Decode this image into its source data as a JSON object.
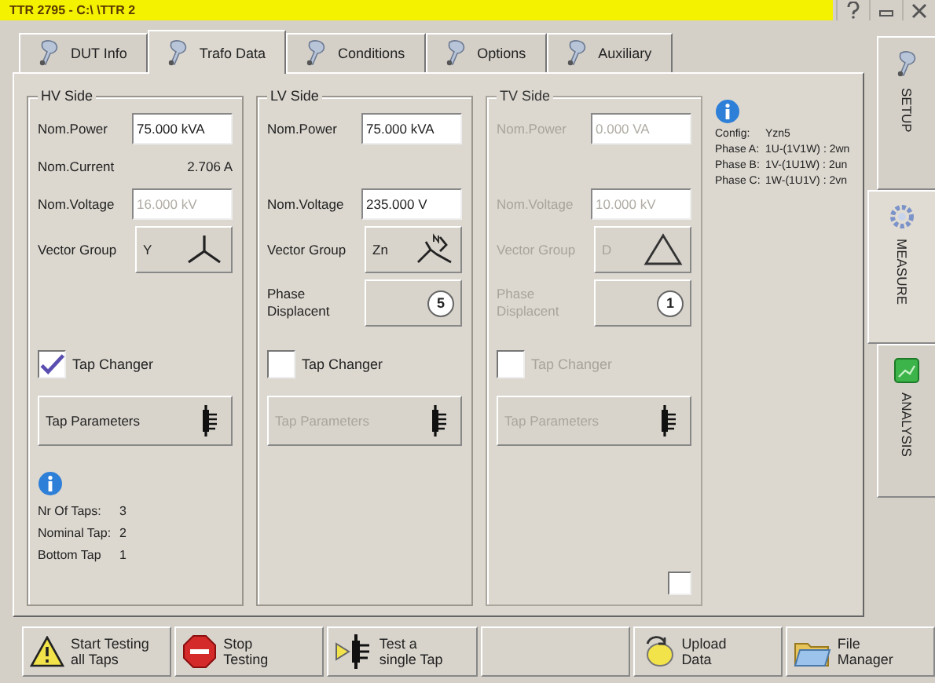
{
  "window": {
    "title": "TTR 2795 - C:\\ \\TTR 2"
  },
  "tabs": [
    {
      "label": "DUT Info",
      "selected": false
    },
    {
      "label": "Trafo Data",
      "selected": true
    },
    {
      "label": "Conditions",
      "selected": false
    },
    {
      "label": "Options",
      "selected": false
    },
    {
      "label": "Auxiliary",
      "selected": false
    }
  ],
  "side_tabs": [
    {
      "label": "SETUP",
      "kind": "wrench",
      "selected": false
    },
    {
      "label": "MEASURE",
      "kind": "gear",
      "selected": true
    },
    {
      "label": "ANALYSIS",
      "kind": "chart",
      "selected": false
    }
  ],
  "sides": [
    {
      "title": "HV Side",
      "disabled": false,
      "fields": [
        {
          "kind": "input",
          "label": "Nom.Power",
          "value": "75.000 kVA",
          "disabled": false
        },
        {
          "kind": "readout",
          "label": "Nom.Current",
          "value": "2.706 A"
        },
        {
          "kind": "input",
          "label": "Nom.Voltage",
          "value": "16.000 kV",
          "disabled": true
        }
      ],
      "vector_group": {
        "label": "Vector Group",
        "value": "Y",
        "kind": "star"
      },
      "tap_changer": {
        "label": "Tap Changer",
        "checked": true
      },
      "tap_parameters": {
        "label": "Tap Parameters",
        "disabled": false
      },
      "tap_info": [
        {
          "label": "Nr Of Taps:",
          "value": "3"
        },
        {
          "label": "Nominal Tap:",
          "value": "2"
        },
        {
          "label": "Bottom Tap",
          "value": "1"
        }
      ]
    },
    {
      "title": "LV Side",
      "disabled": false,
      "fields": [
        {
          "kind": "input",
          "label": "Nom.Power",
          "value": "75.000 kVA",
          "disabled": false
        },
        {
          "kind": "gap"
        },
        {
          "kind": "input",
          "label": "Nom.Voltage",
          "value": "235.000 V",
          "disabled": false
        }
      ],
      "vector_group": {
        "label": "Vector Group",
        "value": "Zn",
        "kind": "zigzag"
      },
      "phase_displacement": {
        "label": "Phase Displacent",
        "value": "5"
      },
      "tap_changer": {
        "label": "Tap Changer",
        "checked": false
      },
      "tap_parameters": {
        "label": "Tap Parameters",
        "disabled": true
      }
    },
    {
      "title": "TV Side",
      "disabled": true,
      "fields": [
        {
          "kind": "input",
          "label": "Nom.Power",
          "value": "0.000 VA",
          "disabled": true
        },
        {
          "kind": "gap"
        },
        {
          "kind": "input",
          "label": "Nom.Voltage",
          "value": "10.000 kV",
          "disabled": true
        }
      ],
      "vector_group": {
        "label": "Vector Group",
        "value": "D",
        "kind": "delta"
      },
      "phase_displacement": {
        "label": "Phase Displacent",
        "value": "1"
      },
      "tap_changer": {
        "label": "Tap Changer",
        "checked": false
      },
      "tap_parameters": {
        "label": "Tap Parameters",
        "disabled": true
      },
      "extra_checkbox": {
        "checked": false
      }
    }
  ],
  "config": [
    {
      "label": "Config:",
      "value": "Yzn5"
    },
    {
      "label": "Phase A:",
      "value": "1U-(1V1W) : 2wn"
    },
    {
      "label": "Phase B:",
      "value": "1V-(1U1W) : 2un"
    },
    {
      "label": "Phase C:",
      "value": "1W-(1U1V) : 2vn"
    }
  ],
  "buttons": [
    {
      "label": "Start Testing\nall Taps",
      "kind": "warning"
    },
    {
      "label": "Stop\nTesting",
      "kind": "stop"
    },
    {
      "label": "Test a\nsingle Tap",
      "kind": "plug"
    },
    {
      "kind": "blank"
    },
    {
      "label": "Upload\nData",
      "kind": "upload"
    },
    {
      "label": "File\nManager",
      "kind": "folder"
    }
  ]
}
